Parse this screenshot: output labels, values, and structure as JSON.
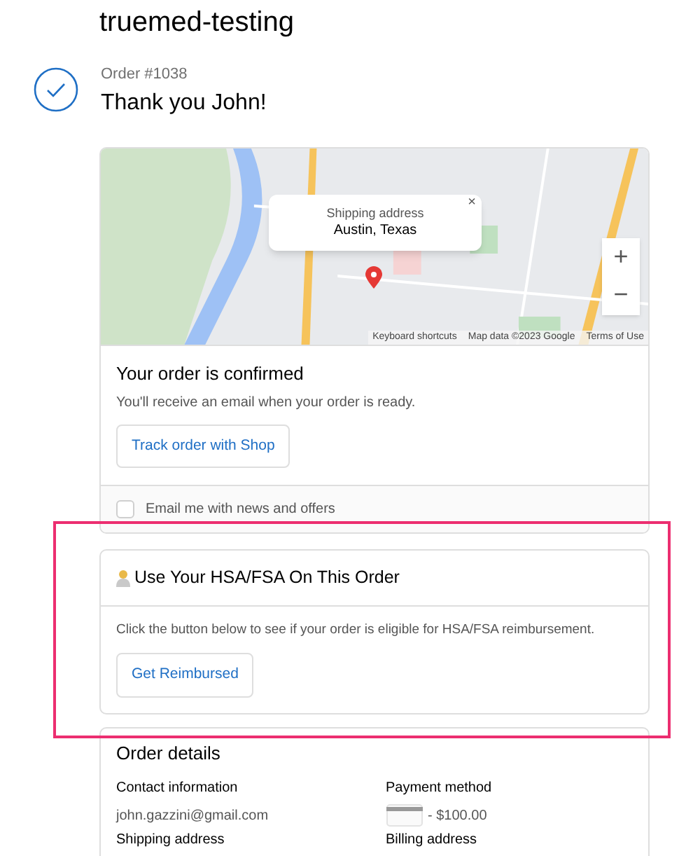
{
  "store_name": "truemed-testing",
  "order": {
    "number": "Order #1038",
    "thanks": "Thank you John!"
  },
  "map": {
    "popup": {
      "label": "Shipping address",
      "place": "Austin, Texas",
      "close": "×"
    },
    "zoom_in": "+",
    "zoom_out": "−",
    "attribution": [
      "Keyboard shortcuts",
      "Map data ©2023 Google",
      "Terms of Use"
    ]
  },
  "confirmation": {
    "title": "Your order is confirmed",
    "message": "You'll receive an email when your order is ready.",
    "button": "Track order with Shop",
    "newsletter": {
      "label": "Email me with news and offers",
      "checked": false
    }
  },
  "hsa": {
    "highlighted": true,
    "title": "Use Your HSA/FSA On This Order",
    "message": "Click the button below to see if your order is eligible for HSA/FSA reimbursement.",
    "button": "Get Reimbursed"
  },
  "order_details": {
    "title": "Order details",
    "sections": [
      {
        "label": "Contact information",
        "kind": "text",
        "value": "john.gazzini@gmail.com"
      },
      {
        "label": "Payment method",
        "kind": "card",
        "value": "- $100.00"
      },
      {
        "label": "Shipping address",
        "kind": "empty"
      },
      {
        "label": "Billing address",
        "kind": "empty"
      }
    ]
  }
}
